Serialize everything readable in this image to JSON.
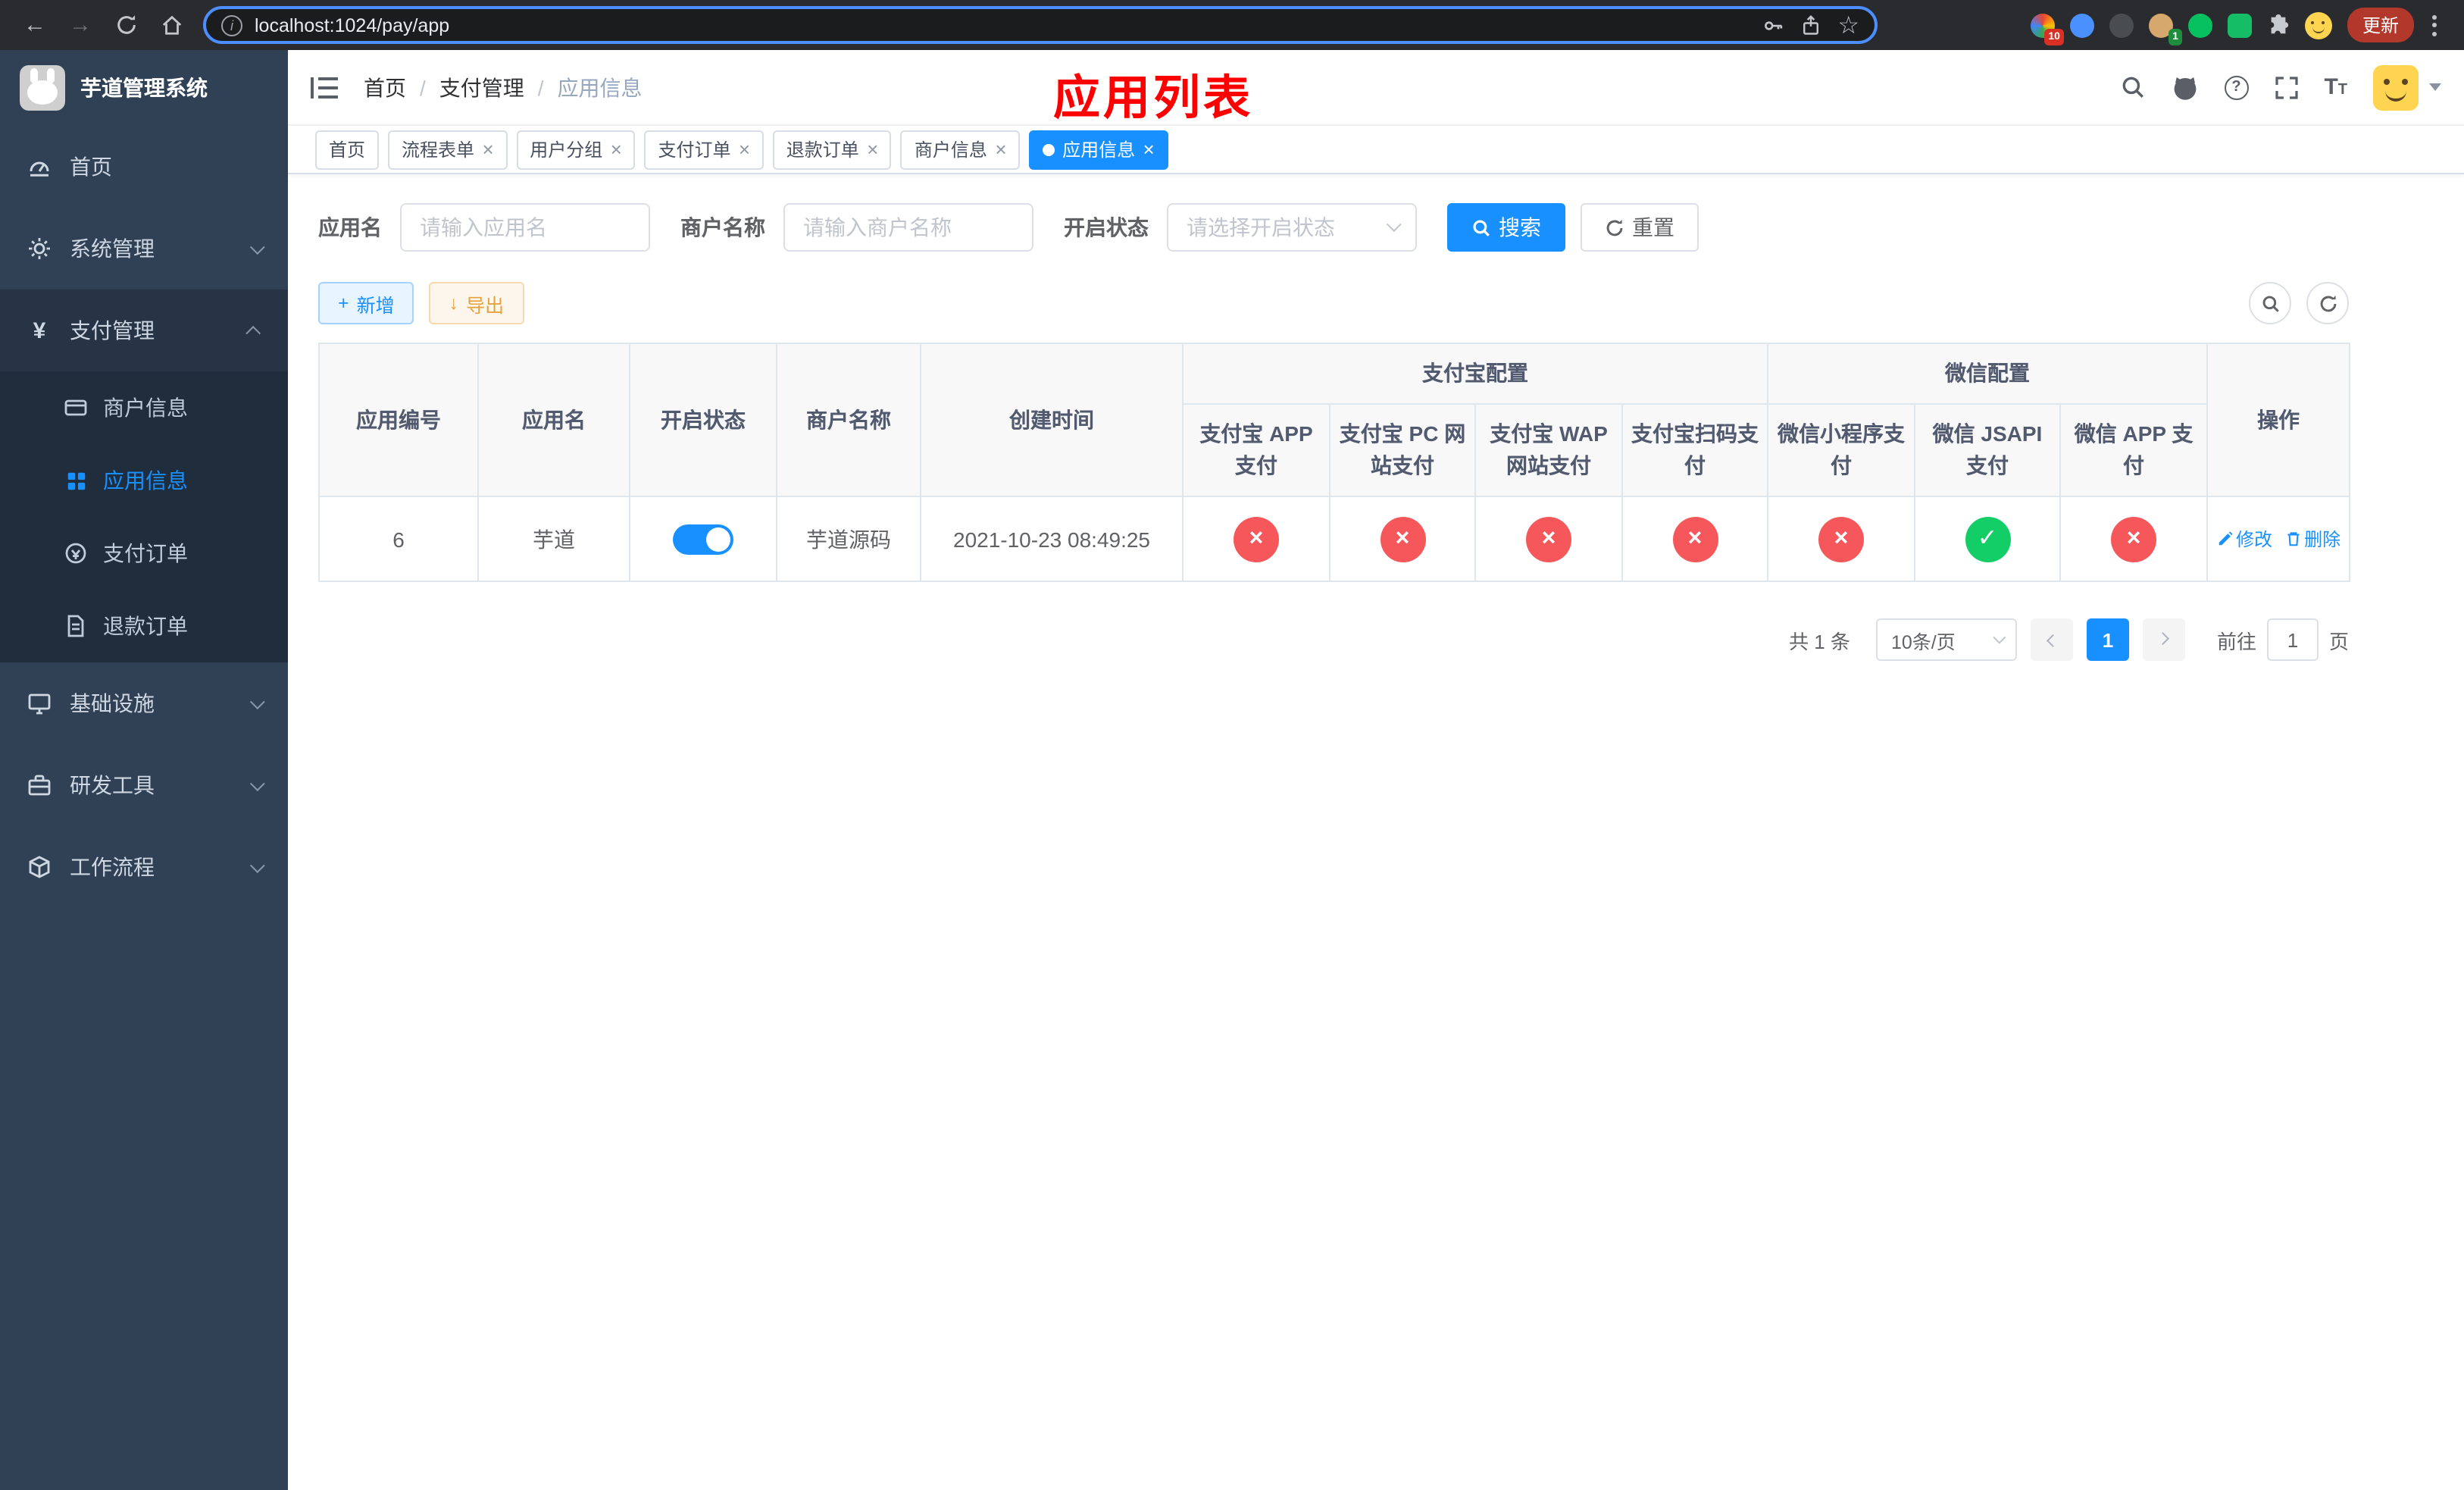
{
  "colors": {
    "primary": "#1890ff",
    "success": "#13ce66",
    "danger": "#f5575b",
    "warning": "#e6a23c",
    "annotation": "#ff0000",
    "sidebar_bg": "#304156",
    "sidebar_submenu_bg": "#1f2d3d"
  },
  "browser": {
    "url": "localhost:1024/pay/app",
    "update_label": "更新",
    "extension_badges": {
      "grid": "10",
      "profile": "1"
    }
  },
  "sidebar": {
    "title": "芋道管理系统",
    "items": [
      {
        "label": "首页"
      },
      {
        "label": "系统管理",
        "has_children": true
      },
      {
        "label": "支付管理",
        "has_children": true,
        "expanded": true,
        "children": [
          {
            "label": "商户信息"
          },
          {
            "label": "应用信息",
            "active": true
          },
          {
            "label": "支付订单"
          },
          {
            "label": "退款订单"
          }
        ]
      },
      {
        "label": "基础设施",
        "has_children": true
      },
      {
        "label": "研发工具",
        "has_children": true
      },
      {
        "label": "工作流程",
        "has_children": true
      }
    ]
  },
  "navbar": {
    "breadcrumb": [
      "首页",
      "支付管理",
      "应用信息"
    ],
    "breadcrumb_separator": "/",
    "annotation": "应用列表"
  },
  "tags": [
    {
      "label": "首页",
      "closable": false,
      "active": false
    },
    {
      "label": "流程表单",
      "closable": true,
      "active": false
    },
    {
      "label": "用户分组",
      "closable": true,
      "active": false
    },
    {
      "label": "支付订单",
      "closable": true,
      "active": false
    },
    {
      "label": "退款订单",
      "closable": true,
      "active": false
    },
    {
      "label": "商户信息",
      "closable": true,
      "active": false
    },
    {
      "label": "应用信息",
      "closable": true,
      "active": true
    }
  ],
  "filters": {
    "app_name_label": "应用名",
    "app_name_placeholder": "请输入应用名",
    "app_name_value": "",
    "merchant_label": "商户名称",
    "merchant_placeholder": "请输入商户名称",
    "merchant_value": "",
    "status_label": "开启状态",
    "status_placeholder": "请选择开启状态",
    "search_label": "搜索",
    "reset_label": "重置"
  },
  "toolbar": {
    "add_label": "新增",
    "export_label": "导出"
  },
  "table": {
    "simple_headers": [
      "应用编号",
      "应用名",
      "开启状态",
      "商户名称",
      "创建时间"
    ],
    "groups": [
      {
        "label": "支付宝配置",
        "children": [
          "支付宝 APP 支付",
          "支付宝 PC 网站支付",
          "支付宝 WAP 网站支付",
          "支付宝扫码支付"
        ]
      },
      {
        "label": "微信配置",
        "children": [
          "微信小程序支付",
          "微信 JSAPI 支付",
          "微信 APP 支付"
        ]
      }
    ],
    "actions_header": "操作",
    "rows": [
      {
        "id": "6",
        "name": "芋道",
        "enabled": true,
        "merchant": "芋道源码",
        "created": "2021-10-23 08:49:25",
        "statuses": [
          false,
          false,
          false,
          false,
          false,
          true,
          false
        ],
        "actions": [
          "修改",
          "删除"
        ]
      }
    ]
  },
  "pagination": {
    "total_label": "共 1 条",
    "page_size_label": "10条/页",
    "current_page": "1",
    "goto_label": "前往",
    "goto_value": "1",
    "page_unit": "页"
  },
  "icons": {
    "back": "left-arrow",
    "forward": "right-arrow",
    "reload": "circular-arrow",
    "home": "house",
    "site-info": "i-in-circle",
    "key": "key",
    "share": "box-up-arrow",
    "bookmark": "star",
    "extensions": "puzzle",
    "menu": "kebab-dots",
    "collapse": "indent-lines",
    "search": "magnifier",
    "github": "octocat",
    "help": "question-circle",
    "fullscreen": "corner-brackets",
    "font-size": "double-T",
    "user-caret": "triangle-down",
    "dashboard": "gauge",
    "system": "gear",
    "payment": "yen-sign",
    "merchant": "bank-card",
    "app": "grid",
    "pay-order": "coin",
    "refund-order": "document",
    "infra": "monitor",
    "devtools": "toolbox",
    "workflow": "cube",
    "add": "plus",
    "export": "down-arrow",
    "refresh": "circular-arrow",
    "edit": "pencil",
    "delete": "trash",
    "pass": "check",
    "fail": "cross",
    "close": "x"
  }
}
